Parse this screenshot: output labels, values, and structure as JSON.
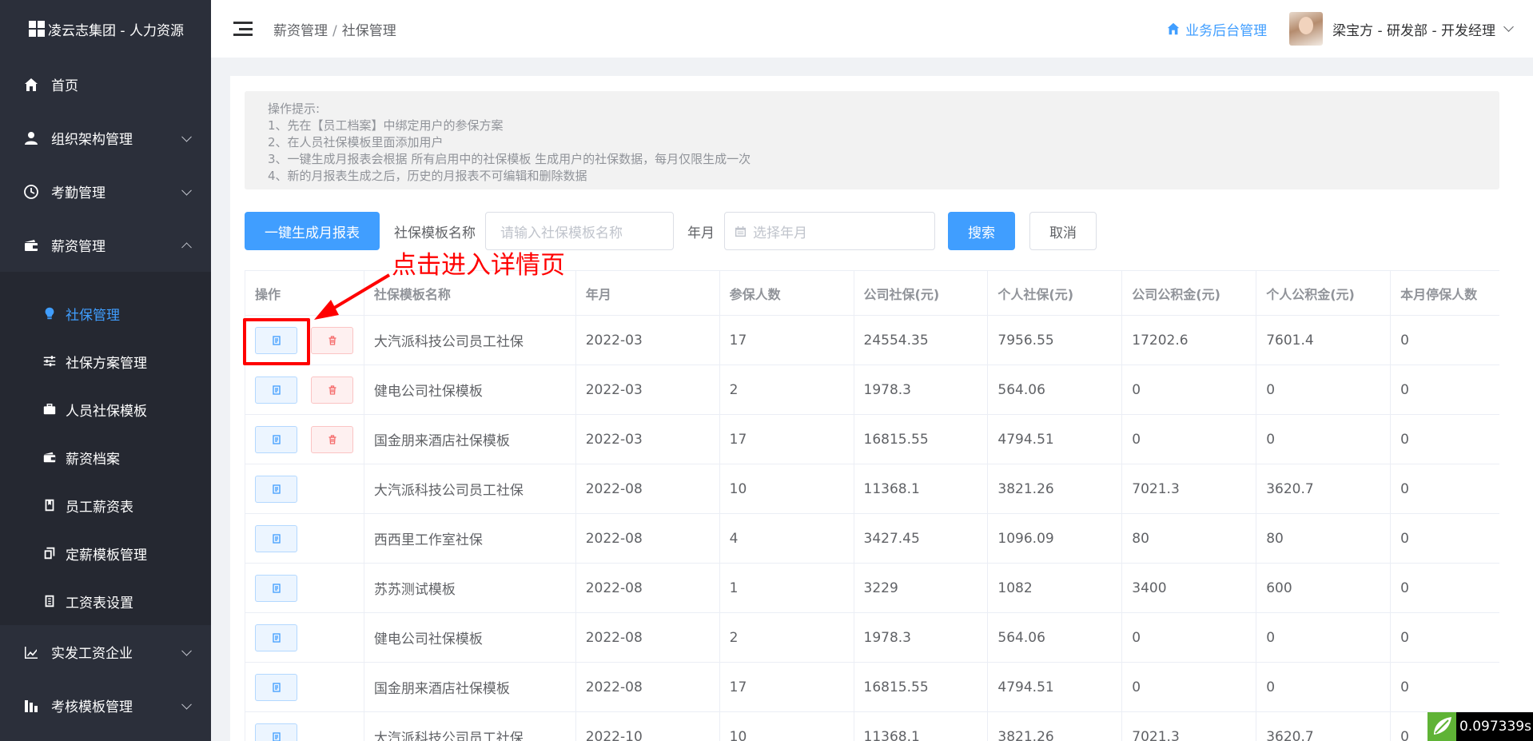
{
  "brand": {
    "title": "凌云志集团 - 人力资源"
  },
  "sidebar": {
    "items": [
      {
        "label": "首页",
        "icon": "home-icon",
        "caret": ""
      },
      {
        "label": "组织架构管理",
        "icon": "user-icon",
        "caret": "down"
      },
      {
        "label": "考勤管理",
        "icon": "clock-icon",
        "caret": "down"
      },
      {
        "label": "薪资管理",
        "icon": "wallet-icon",
        "caret": "up"
      }
    ],
    "sub_items": [
      {
        "label": "社保管理",
        "icon": "lightbulb-icon",
        "active": true
      },
      {
        "label": "社保方案管理",
        "icon": "sliders-icon"
      },
      {
        "label": "人员社保模板",
        "icon": "briefcase-icon"
      },
      {
        "label": "薪资档案",
        "icon": "wallet-icon"
      },
      {
        "label": "员工薪资表",
        "icon": "bookmark-icon"
      },
      {
        "label": "定薪模板管理",
        "icon": "copy-icon"
      },
      {
        "label": "工资表设置",
        "icon": "list-icon"
      }
    ],
    "bottom_items": [
      {
        "label": "实发工资企业",
        "icon": "chart-icon"
      },
      {
        "label": "考核模板管理",
        "icon": "bar-icon"
      }
    ]
  },
  "header": {
    "breadcrumb": [
      "薪资管理",
      "社保管理"
    ],
    "breadcrumb_sep": "/",
    "backend_link": "业务后台管理",
    "user": "梁宝方 - 研发部 - 开发经理"
  },
  "tips": {
    "title": "操作提示:",
    "lines": [
      "1、先在【员工档案】中绑定用户的参保方案",
      "2、在人员社保模板里面添加用户",
      "3、一键生成月报表会根据 所有启用中的社保模板 生成用户的社保数据，每月仅限生成一次",
      "4、新的月报表生成之后，历史的月报表不可编辑和删除数据"
    ]
  },
  "toolbar": {
    "generate_label": "一键生成月报表",
    "template_label": "社保模板名称",
    "template_placeholder": "请输入社保模板名称",
    "month_label": "年月",
    "month_placeholder": "选择年月",
    "search_label": "搜索",
    "cancel_label": "取消"
  },
  "table": {
    "columns": [
      "操作",
      "社保模板名称",
      "年月",
      "参保人数",
      "公司社保(元)",
      "个人社保(元)",
      "公司公积金(元)",
      "个人公积金(元)",
      "本月停保人数"
    ],
    "rows": [
      {
        "deletable": true,
        "cells": [
          "大汽派科技公司员工社保",
          "2022-03",
          "17",
          "24554.35",
          "7956.55",
          "17202.6",
          "7601.4",
          "0"
        ]
      },
      {
        "deletable": true,
        "cells": [
          "健电公司社保模板",
          "2022-03",
          "2",
          "1978.3",
          "564.06",
          "0",
          "0",
          "0"
        ]
      },
      {
        "deletable": true,
        "cells": [
          "国金朋来酒店社保模板",
          "2022-03",
          "17",
          "16815.55",
          "4794.51",
          "0",
          "0",
          "0"
        ]
      },
      {
        "deletable": false,
        "cells": [
          "大汽派科技公司员工社保",
          "2022-08",
          "10",
          "11368.1",
          "3821.26",
          "7021.3",
          "3620.7",
          "0"
        ]
      },
      {
        "deletable": false,
        "cells": [
          "西西里工作室社保",
          "2022-08",
          "4",
          "3427.45",
          "1096.09",
          "80",
          "80",
          "0"
        ]
      },
      {
        "deletable": false,
        "cells": [
          "苏苏测试模板",
          "2022-08",
          "1",
          "3229",
          "1082",
          "3400",
          "600",
          "0"
        ]
      },
      {
        "deletable": false,
        "cells": [
          "健电公司社保模板",
          "2022-08",
          "2",
          "1978.3",
          "564.06",
          "0",
          "0",
          "0"
        ]
      },
      {
        "deletable": false,
        "cells": [
          "国金朋来酒店社保模板",
          "2022-08",
          "17",
          "16815.55",
          "4794.51",
          "0",
          "0",
          "0"
        ]
      },
      {
        "deletable": false,
        "cells": [
          "大汽派科技公司员工社保",
          "2022-10",
          "10",
          "11368.1",
          "3821.26",
          "7021.3",
          "3620.7",
          "0"
        ]
      }
    ]
  },
  "annotation": {
    "text": "点击进入详情页",
    "color": "#ff0000"
  },
  "timer": {
    "value": "0.097339s"
  },
  "colors": {
    "sidebar_bg": "#2b2f3a",
    "accent": "#409eff",
    "danger": "#f56c6c"
  }
}
